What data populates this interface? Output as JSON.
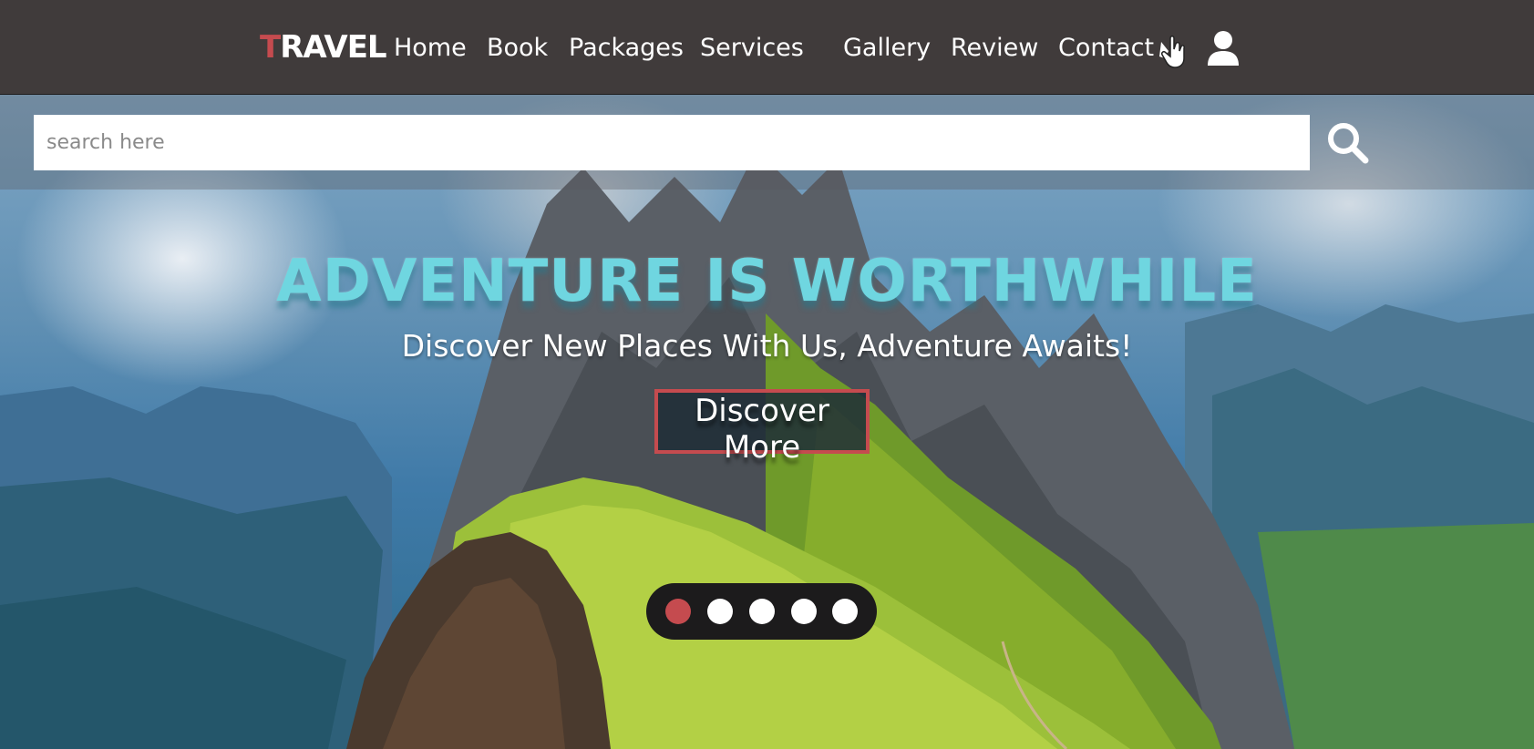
{
  "nav": {
    "logo_first": "T",
    "logo_rest": "RAVEL",
    "links": [
      "Home",
      "Book",
      "Packages",
      "Services",
      "Gallery",
      "Review",
      "Contact"
    ],
    "icons": [
      "hand-pointer-icon",
      "user-icon"
    ]
  },
  "search": {
    "placeholder": "search here",
    "value": "",
    "icon": "search-icon"
  },
  "hero": {
    "title": "ADVENTURE IS WORTHWHILE",
    "subtitle": "Discover New Places With Us, Adventure Awaits!",
    "button_label": "Discover More"
  },
  "slider": {
    "dot_count": 5,
    "active_index": 0
  },
  "colors": {
    "accent": "#c54b4f",
    "title": "#6fd6e0",
    "navbar": "#403b3b"
  }
}
